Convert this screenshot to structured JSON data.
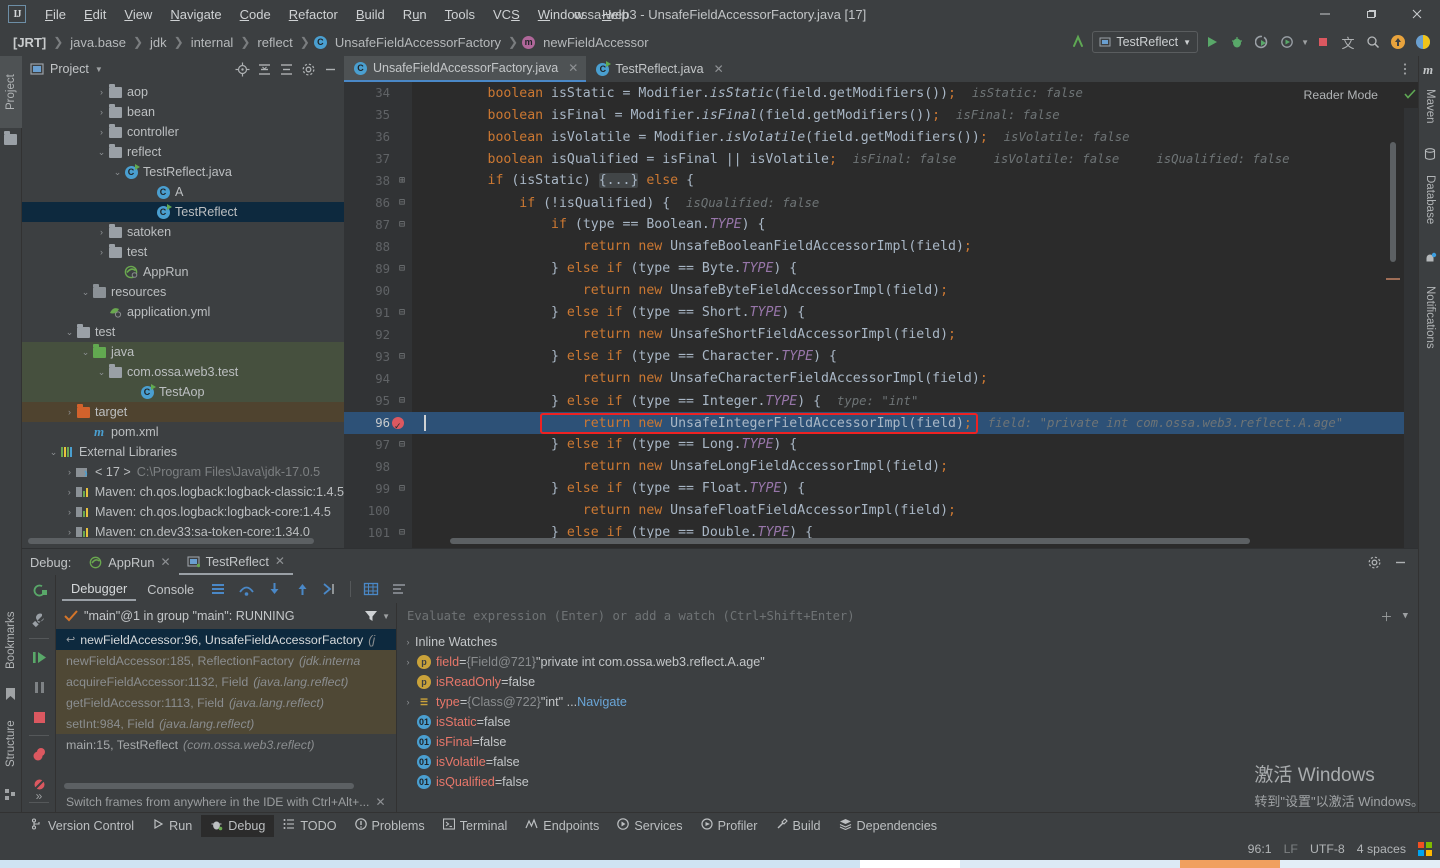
{
  "titlebar": {
    "app_icon": "intellij-logo",
    "menu": [
      "File",
      "Edit",
      "View",
      "Navigate",
      "Code",
      "Refactor",
      "Build",
      "Run",
      "Tools",
      "VCS",
      "Window",
      "Help"
    ],
    "window_title": "ossa-web3 - UnsafeFieldAccessorFactory.java [17]",
    "minimize": "—",
    "maximize": "❐",
    "close": "✕"
  },
  "navbar": {
    "crumbs": [
      "[JRT]",
      "java.base",
      "jdk",
      "internal",
      "reflect",
      "UnsafeFieldAccessorFactory",
      "newFieldAccessor"
    ],
    "run_config": "TestReflect",
    "icons": [
      "back-arrow-icon",
      "run-icon",
      "debug-icon",
      "run-with-coverage-icon",
      "profile-icon",
      "stop-icon",
      "translate-icon",
      "search-icon",
      "update-icon",
      "ai-icon"
    ]
  },
  "left_strip": {
    "project_tab": "Project",
    "bookmarks_tab": "Bookmarks",
    "structure_tab": "Structure"
  },
  "right_strip": {
    "maven_tab": "Maven",
    "database_tab": "Database",
    "notifications_tab": "Notifications"
  },
  "project_panel": {
    "title": "Project",
    "tree": [
      {
        "label": "aop",
        "indent": 4,
        "arrow": "›",
        "icon": "folder-gray",
        "state": "normal"
      },
      {
        "label": "bean",
        "indent": 4,
        "arrow": "›",
        "icon": "folder-gray",
        "state": "normal"
      },
      {
        "label": "controller",
        "indent": 4,
        "arrow": "›",
        "icon": "folder-gray",
        "state": "normal"
      },
      {
        "label": "reflect",
        "indent": 4,
        "arrow": "⌄",
        "icon": "folder-gray",
        "state": "normal"
      },
      {
        "label": "TestReflect.java",
        "indent": 5,
        "arrow": "⌄",
        "icon": "class-run",
        "state": "normal"
      },
      {
        "label": "A",
        "indent": 7,
        "arrow": "",
        "icon": "class",
        "state": "normal"
      },
      {
        "label": "TestReflect",
        "indent": 7,
        "arrow": "",
        "icon": "class-run",
        "state": "selected"
      },
      {
        "label": "satoken",
        "indent": 4,
        "arrow": "›",
        "icon": "folder-gray",
        "state": "normal"
      },
      {
        "label": "test",
        "indent": 4,
        "arrow": "›",
        "icon": "folder-gray",
        "state": "normal"
      },
      {
        "label": "AppRun",
        "indent": 5,
        "arrow": "",
        "icon": "spring-run",
        "state": "normal"
      },
      {
        "label": "resources",
        "indent": 3,
        "arrow": "⌄",
        "icon": "folder-res",
        "state": "normal"
      },
      {
        "label": "application.yml",
        "indent": 4,
        "arrow": "",
        "icon": "yml",
        "state": "normal"
      },
      {
        "label": "test",
        "indent": 2,
        "arrow": "⌄",
        "icon": "folder-gray",
        "state": "normal"
      },
      {
        "label": "java",
        "indent": 3,
        "arrow": "⌄",
        "icon": "folder-green",
        "state": "green"
      },
      {
        "label": "com.ossa.web3.test",
        "indent": 4,
        "arrow": "⌄",
        "icon": "folder-gray",
        "state": "green"
      },
      {
        "label": "TestAop",
        "indent": 6,
        "arrow": "",
        "icon": "class-run",
        "state": "green"
      },
      {
        "label": "target",
        "indent": 2,
        "arrow": "›",
        "icon": "folder-orange",
        "state": "orange"
      },
      {
        "label": "pom.xml",
        "indent": 3,
        "arrow": "",
        "icon": "maven-m",
        "state": "normal"
      },
      {
        "label": "External Libraries",
        "indent": 1,
        "arrow": "⌄",
        "icon": "libraries",
        "state": "normal"
      },
      {
        "label": "< 17 >",
        "indent": 2,
        "arrow": "›",
        "icon": "jdk",
        "state": "normal",
        "suffix": "C:\\Program Files\\Java\\jdk-17.0.5"
      },
      {
        "label": "Maven: ch.qos.logback:logback-classic:1.4.5",
        "indent": 2,
        "arrow": "›",
        "icon": "maven-lib",
        "state": "normal"
      },
      {
        "label": "Maven: ch.qos.logback:logback-core:1.4.5",
        "indent": 2,
        "arrow": "›",
        "icon": "maven-lib",
        "state": "normal"
      },
      {
        "label": "Maven: cn.dev33:sa-token-core:1.34.0",
        "indent": 2,
        "arrow": "›",
        "icon": "maven-lib",
        "state": "normal"
      }
    ]
  },
  "editor": {
    "tabs": [
      {
        "label": "UnsafeFieldAccessorFactory.java",
        "icon": "class-icon",
        "active": true
      },
      {
        "label": "TestReflect.java",
        "icon": "class-run-icon",
        "active": false
      }
    ],
    "reader_mode": "Reader Mode",
    "lines": [
      {
        "no": "34",
        "fold": "",
        "code": "        boolean isStatic = Modifier.isStatic(field.getModifiers());",
        "hint": "isStatic: false"
      },
      {
        "no": "35",
        "fold": "",
        "code": "        boolean isFinal = Modifier.isFinal(field.getModifiers());",
        "hint": "isFinal: false"
      },
      {
        "no": "36",
        "fold": "",
        "code": "        boolean isVolatile = Modifier.isVolatile(field.getModifiers());",
        "hint": "isVolatile: false"
      },
      {
        "no": "37",
        "fold": "",
        "code": "        boolean isQualified = isFinal || isVolatile;",
        "hint": "isFinal: false     isVolatile: false     isQualified: false"
      },
      {
        "no": "38",
        "fold": "+",
        "code": "        if (isStatic) {...} else {",
        "hint": ""
      },
      {
        "no": "86",
        "fold": "-",
        "code": "            if (!isQualified) {",
        "hint": "isQualified: false"
      },
      {
        "no": "87",
        "fold": "-",
        "code": "                if (type == Boolean.TYPE) {",
        "hint": ""
      },
      {
        "no": "88",
        "fold": "",
        "code": "                    return new UnsafeBooleanFieldAccessorImpl(field);",
        "hint": ""
      },
      {
        "no": "89",
        "fold": "-",
        "code": "                } else if (type == Byte.TYPE) {",
        "hint": ""
      },
      {
        "no": "90",
        "fold": "",
        "code": "                    return new UnsafeByteFieldAccessorImpl(field);",
        "hint": ""
      },
      {
        "no": "91",
        "fold": "-",
        "code": "                } else if (type == Short.TYPE) {",
        "hint": ""
      },
      {
        "no": "92",
        "fold": "",
        "code": "                    return new UnsafeShortFieldAccessorImpl(field);",
        "hint": ""
      },
      {
        "no": "93",
        "fold": "-",
        "code": "                } else if (type == Character.TYPE) {",
        "hint": ""
      },
      {
        "no": "94",
        "fold": "",
        "code": "                    return new UnsafeCharacterFieldAccessorImpl(field);",
        "hint": ""
      },
      {
        "no": "95",
        "fold": "-",
        "code": "                } else if (type == Integer.TYPE) {",
        "hint": "type: \"int\""
      },
      {
        "no": "96",
        "fold": "",
        "code": "                    return new UnsafeIntegerFieldAccessorImpl(field);",
        "hint": "field: \"private int com.ossa.web3.reflect.A.age\"",
        "current": true,
        "breakpoint": true
      },
      {
        "no": "97",
        "fold": "-",
        "code": "                } else if (type == Long.TYPE) {",
        "hint": ""
      },
      {
        "no": "98",
        "fold": "",
        "code": "                    return new UnsafeLongFieldAccessorImpl(field);",
        "hint": ""
      },
      {
        "no": "99",
        "fold": "-",
        "code": "                } else if (type == Float.TYPE) {",
        "hint": ""
      },
      {
        "no": "100",
        "fold": "",
        "code": "                    return new UnsafeFloatFieldAccessorImpl(field);",
        "hint": ""
      },
      {
        "no": "101",
        "fold": "-",
        "code": "                } else if (type == Double.TYPE) {",
        "hint": ""
      }
    ]
  },
  "debug_panel": {
    "label": "Debug:",
    "tabs": [
      {
        "label": "AppRun",
        "icon": "spring-run-icon",
        "active": false
      },
      {
        "label": "TestReflect",
        "icon": "class-run-icon",
        "active": true
      }
    ],
    "sub_tabs": [
      "Debugger",
      "Console"
    ],
    "active_sub_tab": "Debugger",
    "thread_status": "\"main\"@1 in group \"main\": RUNNING",
    "frames": [
      {
        "text": "newFieldAccessor:96, UnsafeFieldAccessorFactory",
        "pkg": "(j",
        "state": "selected"
      },
      {
        "text": "newFieldAccessor:185, ReflectionFactory",
        "pkg": "(jdk.interna",
        "state": "lib"
      },
      {
        "text": "acquireFieldAccessor:1132, Field",
        "pkg": "(java.lang.reflect)",
        "state": "lib"
      },
      {
        "text": "getFieldAccessor:1113, Field",
        "pkg": "(java.lang.reflect)",
        "state": "lib"
      },
      {
        "text": "setInt:984, Field",
        "pkg": "(java.lang.reflect)",
        "state": "lib"
      },
      {
        "text": "main:15, TestReflect",
        "pkg": "(com.ossa.web3.reflect)",
        "state": "normal"
      }
    ],
    "frames_hint": "Switch frames from anywhere in the IDE with Ctrl+Alt+...",
    "evaluate_placeholder": "Evaluate expression (Enter) or add a watch (Ctrl+Shift+Enter)",
    "variables": [
      {
        "toggle": "›",
        "icon": "",
        "name": "Inline Watches",
        "eq": "",
        "value": "",
        "kind": "group"
      },
      {
        "toggle": "›",
        "icon": "p",
        "name": "field",
        "eq": "=",
        "ref": "{Field@721}",
        "value": "\"private int com.ossa.web3.reflect.A.age\"",
        "kind": "field"
      },
      {
        "toggle": "",
        "icon": "p",
        "name": "isReadOnly",
        "eq": "=",
        "ref": "",
        "value": "false",
        "kind": "field"
      },
      {
        "toggle": "›",
        "icon": "eq",
        "name": "type",
        "eq": "=",
        "ref": "{Class@722}",
        "value": "\"int\" ...",
        "link": "Navigate",
        "kind": "field"
      },
      {
        "toggle": "",
        "icon": "01",
        "name": "isStatic",
        "eq": "=",
        "ref": "",
        "value": "false",
        "kind": "primitive"
      },
      {
        "toggle": "",
        "icon": "01",
        "name": "isFinal",
        "eq": "=",
        "ref": "",
        "value": "false",
        "kind": "primitive"
      },
      {
        "toggle": "",
        "icon": "01",
        "name": "isVolatile",
        "eq": "=",
        "ref": "",
        "value": "false",
        "kind": "primitive"
      },
      {
        "toggle": "",
        "icon": "01",
        "name": "isQualified",
        "eq": "=",
        "ref": "",
        "value": "false",
        "kind": "primitive"
      }
    ]
  },
  "watermark": {
    "line1": "激活 Windows",
    "line2": "转到\"设置\"以激活 Windows。"
  },
  "bottom_bar": {
    "items": [
      {
        "label": "Version Control",
        "icon": "branch-icon",
        "active": false
      },
      {
        "label": "Run",
        "icon": "play-icon",
        "active": false
      },
      {
        "label": "Debug",
        "icon": "bug-icon",
        "active": true
      },
      {
        "label": "TODO",
        "icon": "list-icon",
        "active": false
      },
      {
        "label": "Problems",
        "icon": "warning-icon",
        "active": false
      },
      {
        "label": "Terminal",
        "icon": "terminal-icon",
        "active": false
      },
      {
        "label": "Endpoints",
        "icon": "endpoints-icon",
        "active": false
      },
      {
        "label": "Services",
        "icon": "services-icon",
        "active": false
      },
      {
        "label": "Profiler",
        "icon": "profiler-icon",
        "active": false
      },
      {
        "label": "Build",
        "icon": "hammer-icon",
        "active": false
      },
      {
        "label": "Dependencies",
        "icon": "layers-icon",
        "active": false
      }
    ]
  },
  "status_bar": {
    "caret": "96:1",
    "line_sep": "LF",
    "encoding": "UTF-8",
    "indent": "4 spaces",
    "flag": "windows-flag-icon"
  },
  "colors": {
    "accent_blue": "#4a88c7",
    "selection_blue": "#2d5177",
    "tree_selection": "#0d293e",
    "red_box": "#ee2222",
    "keyword_orange": "#cc7832",
    "string_green": "#6a8759",
    "field_purple": "#9876aa",
    "editor_bg": "#2b2b2b",
    "panel_bg": "#3c3f41"
  }
}
